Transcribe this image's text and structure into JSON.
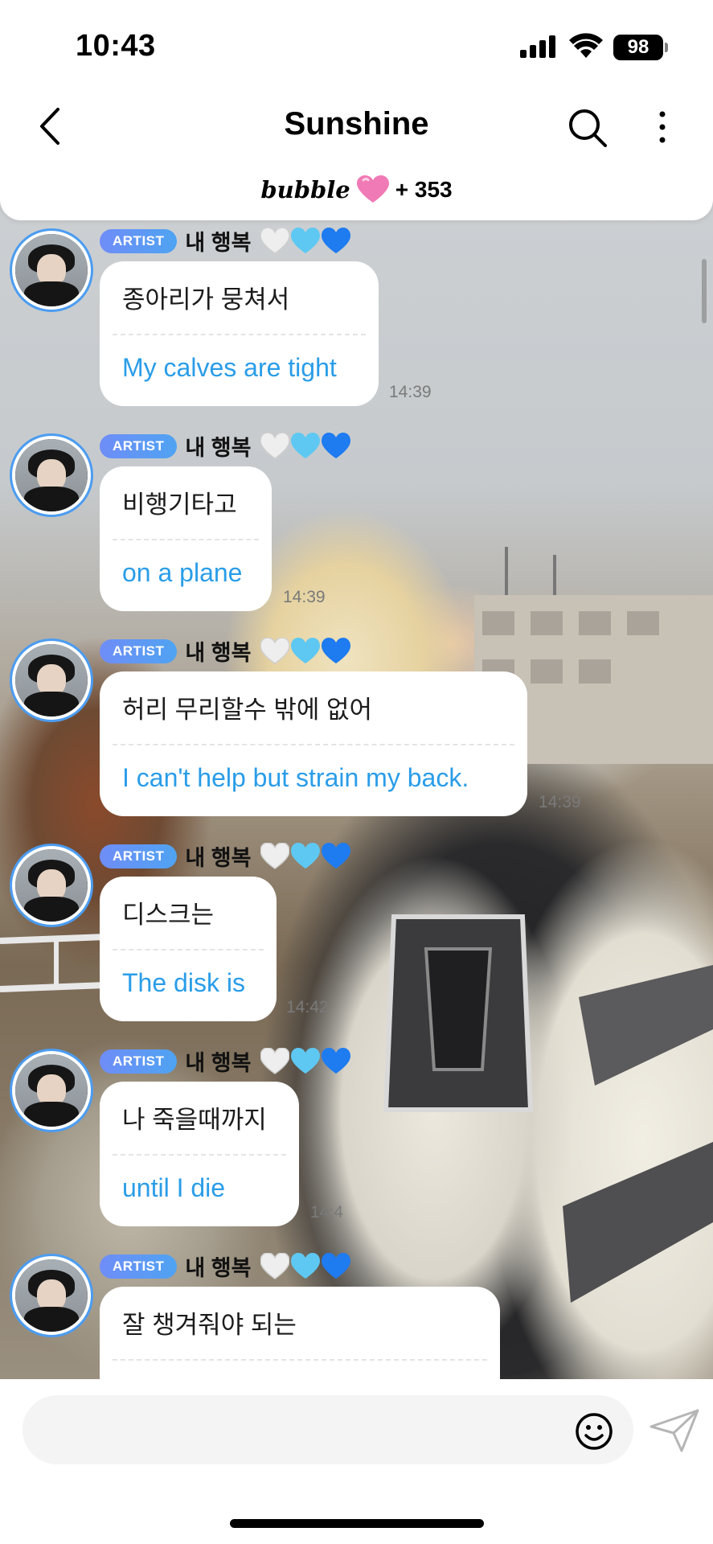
{
  "status_bar": {
    "time": "10:43",
    "battery": "98"
  },
  "header": {
    "title": "Sunshine",
    "brand": "bubble",
    "count": "+ 353"
  },
  "icons": {
    "back": "chevron-left-icon",
    "search": "search-icon",
    "more": "more-vertical-icon",
    "emoji": "smile-icon",
    "send": "paper-plane-icon",
    "hearts": [
      "white-heart-icon",
      "light-blue-heart-icon",
      "blue-heart-icon"
    ]
  },
  "colors": {
    "translation_text": "#2a9de8",
    "artist_badge": "#5b96f3",
    "avatar_ring": "#4c9cf0"
  },
  "messages": [
    {
      "badge": "ARTIST",
      "sender": "내 행복",
      "korean": "종아리가 뭉쳐서",
      "english": "My calves are tight",
      "time": "14:39"
    },
    {
      "badge": "ARTIST",
      "sender": "내 행복",
      "korean": "비행기타고",
      "english": "on a plane",
      "time": "14:39"
    },
    {
      "badge": "ARTIST",
      "sender": "내 행복",
      "korean": "허리 무리할수 밖에 없어",
      "english": "I can't help but strain my back.",
      "time": "14:39"
    },
    {
      "badge": "ARTIST",
      "sender": "내 행복",
      "korean": "디스크는",
      "english": "The disk is",
      "time": "14:42"
    },
    {
      "badge": "ARTIST",
      "sender": "내 행복",
      "korean": "나 죽을때까지",
      "english": "until I die",
      "time": "14:4"
    },
    {
      "badge": "ARTIST",
      "sender": "내 행복",
      "korean": "잘 챙겨줘야 되는",
      "english": "",
      "time": ""
    }
  ],
  "composer": {
    "placeholder": ""
  }
}
